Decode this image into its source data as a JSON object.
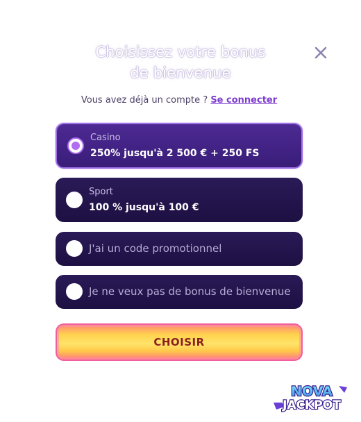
{
  "modal": {
    "title_line1": "Choisissez votre bonus",
    "title_line2": "de bienvenue",
    "account_prompt": "Vous avez déjà un compte ?",
    "login_link": "Se connecter",
    "close_icon": "close-icon"
  },
  "options": [
    {
      "label": "Casino",
      "value": "250% jusqu'à 2 500 € + 250 FS",
      "selected": true
    },
    {
      "label": "Sport",
      "value": "100 % jusqu'à 100 €",
      "selected": false
    },
    {
      "text": "J'ai un code promotionnel",
      "selected": false
    },
    {
      "text": "Je ne veux pas de bonus de bienvenue",
      "selected": false
    }
  ],
  "button": {
    "label": "CHOISIR"
  },
  "brand": {
    "line1": "NOVA",
    "line2": "JACKPOT"
  },
  "colors": {
    "accent": "#a06fe6",
    "option_bg": "#1d1042",
    "selected_bg": "#391d79",
    "button_yellow": "#ffe36a",
    "button_text": "#8a1e1e"
  }
}
